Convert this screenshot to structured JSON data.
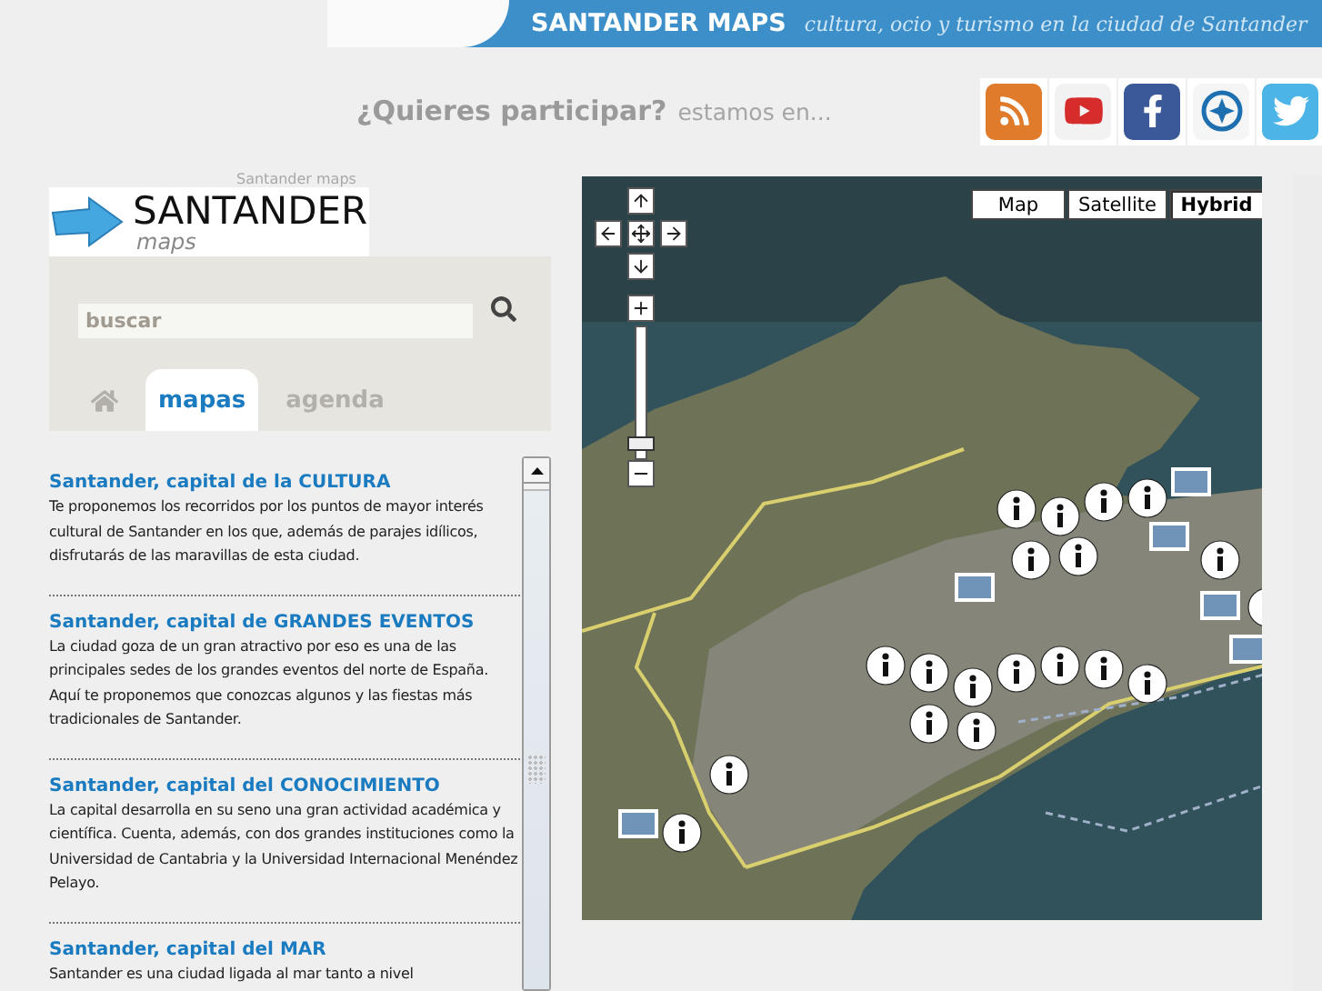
{
  "header": {
    "title": "SANTANDER MAPS",
    "tagline": "cultura, ocio y turismo en la ciudad de Santander"
  },
  "participate": {
    "question": "¿Quieres participar?",
    "text": "estamos en..."
  },
  "social": [
    {
      "kind": "rss"
    },
    {
      "kind": "youtube"
    },
    {
      "kind": "facebook"
    },
    {
      "kind": "compass"
    },
    {
      "kind": "twitter"
    }
  ],
  "logo": {
    "alt": "Santander maps",
    "name": "SANTANDER",
    "sub": "maps"
  },
  "search": {
    "placeholder": "buscar"
  },
  "tabs": [
    {
      "kind": "home",
      "selected": false
    },
    {
      "kind": "text",
      "label": "mapas",
      "selected": true
    },
    {
      "kind": "text",
      "label": "agenda",
      "selected": false
    }
  ],
  "articles": [
    {
      "title": "Santander, capital de la CULTURA",
      "text": "Te proponemos los recorridos por los puntos de mayor interés cultural de Santander en los que, además de parajes idílicos, disfrutarás de las maravillas de esta ciudad."
    },
    {
      "title": "Santander, capital de GRANDES EVENTOS",
      "text": "La ciudad goza de un gran atractivo por eso es una de las principales sedes de los grandes eventos del norte de España. Aquí te proponemos que conozcas algunos y las fiestas más tradicionales de Santander."
    },
    {
      "title": "Santander, capital del CONOCIMIENTO",
      "text": "La capital desarrolla en su seno una gran actividad académica y científica. Cuenta, además, con dos grandes instituciones como la Universidad de Cantabria y la Universidad Internacional Menéndez Pelayo."
    },
    {
      "title": "Santander, capital del MAR",
      "text": "Santander es una ciudad ligada al mar tanto a nivel"
    }
  ],
  "map": {
    "types": [
      {
        "label": "Map",
        "selected": false
      },
      {
        "label": "Satellite",
        "selected": false
      },
      {
        "label": "Hybrid",
        "selected": true
      }
    ],
    "zoom": {
      "level": 0.04
    }
  }
}
